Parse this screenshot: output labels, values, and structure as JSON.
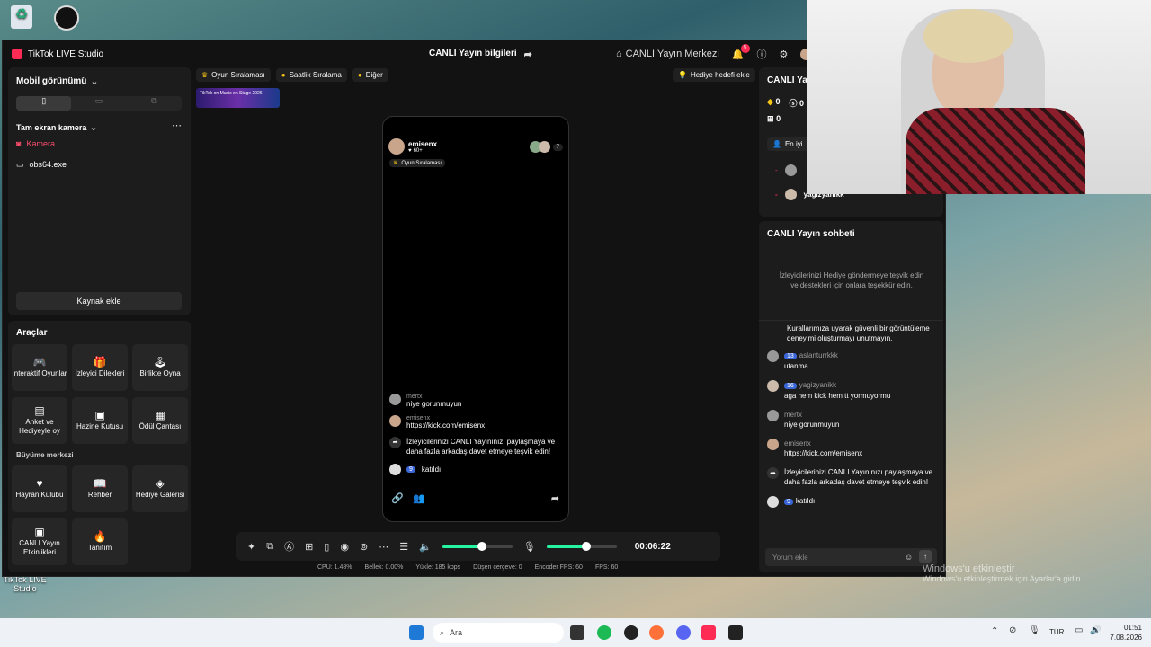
{
  "desktop": {
    "icons": [
      {
        "label": ""
      },
      {
        "label": ""
      }
    ],
    "tiktok_live_label": "TikTok LIVE\nStudio",
    "watermark1": "Windows'u etkinleştir",
    "watermark2": "Windows'u etkinleştirmek için Ayarlar'a gidin."
  },
  "app": {
    "title": "TikTok LIVE Studio",
    "live_info": "CANLI Yayın bilgileri",
    "live_center": "CANLI Yayın Merkezi",
    "notif_count": "5",
    "left": {
      "view_label": "Mobil görünümü",
      "scene_label": "Tam ekran kamera",
      "sources": [
        {
          "label": "Kamera"
        },
        {
          "label": "obs64.exe"
        }
      ],
      "add_source": "Kaynak ekle",
      "tools_title": "Araçlar",
      "tools": [
        "İnteraktif Oyunlar",
        "İzleyici Dilekleri",
        "Birlikte Oyna",
        "Anket ve Hediyeyle oy",
        "Hazine Kutusu",
        "Ödül Çantası"
      ],
      "growth_title": "Büyüme merkezi",
      "growth": [
        "Hayran Kulübü",
        "Rehber",
        "Hediye Galerisi",
        "CANLI Yayın Etkinlikleri",
        "Tanıtım"
      ]
    },
    "center": {
      "chips": [
        "Oyun Sıralaması",
        "Saatlik Sıralama",
        "Diğer"
      ],
      "gift_goal": "Hediye hedefi ekle",
      "banner": "TikTok on Music on Stage 2026",
      "phone": {
        "user": "emisenx",
        "likes": "60+",
        "viewers": "7",
        "rank_chip": "Oyun Sıralaması",
        "messages": [
          {
            "user": "mertx",
            "text": "niye gorunmuyun"
          },
          {
            "user": "emisenx",
            "text": "https://kick.com/emisenx"
          },
          {
            "user": "",
            "text": "İzleyicilerinizi CANLI Yayınınızı paylaşmaya ve daha fazla arkadaş davet etmeye teşvik edin!"
          },
          {
            "user": "",
            "text": "katıldı",
            "badge": "9"
          }
        ]
      },
      "timer": "00:06:22",
      "mic_level": 0.57,
      "speaker_level": 0.57
    },
    "status": {
      "cpu": "CPU: 1.48%",
      "mem": "Bellek: 0.00%",
      "upload": "Yükle: 185 kbps",
      "dropped": "Düşen çerçeve: 0",
      "enc_fps": "Encoder FPS: 60",
      "fps": "FPS: 60"
    },
    "right": {
      "title": "CANLI Yay",
      "diamonds": "0",
      "coins": "0",
      "gifts": "0",
      "top_label": "En iyi",
      "top_user": "yagizyanikk",
      "chat_title": "CANLI Yayın sohbeti",
      "chat_hint": "İzleyicilerinizi Hediye göndermeye teşvik edin ve destekleri için onlara teşekkür edin.",
      "chat_partial": "Kurallarımıza uyarak güvenli bir görüntüleme deneyimi oluşturmayı unutmayın.",
      "messages": [
        {
          "badge": "13",
          "user": "aslanturrkkk",
          "text": "utanma"
        },
        {
          "badge": "16",
          "user": "yagizyanikk",
          "text": "aga hem kick hem tt yormuyormu"
        },
        {
          "badge": "",
          "user": "mertx",
          "text": "niye gorunmuyun"
        },
        {
          "badge": "",
          "user": "emisenx",
          "text": "https://kick.com/emisenx"
        },
        {
          "badge": "",
          "user": "",
          "text": "İzleyicilerinizi CANLI Yayınınızı paylaşmaya ve daha fazla arkadaş davet etmeye teşvik edin!"
        },
        {
          "badge": "9",
          "user": "",
          "text": "katıldı"
        }
      ],
      "comment_placeholder": "Yorum ekle"
    }
  },
  "taskbar": {
    "search": "Ara",
    "lang": "TUR",
    "time": "01:51",
    "date": "7.08.2026"
  }
}
